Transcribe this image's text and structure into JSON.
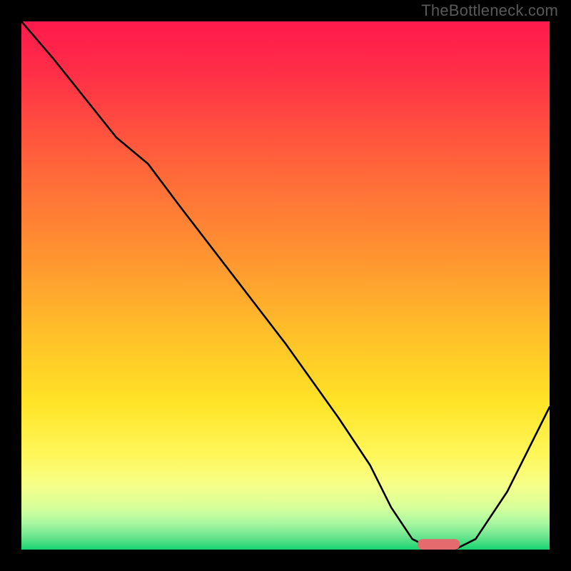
{
  "watermark": "TheBottleneck.com",
  "colors": {
    "curve": "#000000",
    "marker": "#e46a6e",
    "gradient_top": "#ff1a4d",
    "gradient_bottom": "#17d470"
  },
  "chart_data": {
    "type": "line",
    "title": "",
    "xlabel": "",
    "ylabel": "",
    "xlim": [
      0,
      100
    ],
    "ylim": [
      0,
      100
    ],
    "x": [
      0,
      6,
      18,
      24,
      30,
      40,
      50,
      60,
      66,
      70,
      74,
      78,
      82,
      86,
      92,
      100
    ],
    "values": [
      100,
      93,
      78,
      73,
      65,
      52,
      39,
      25,
      16,
      8,
      2,
      0,
      0,
      2,
      11,
      27
    ],
    "marker": {
      "x_start": 75,
      "x_end": 83,
      "y": 0,
      "height": 2
    }
  }
}
